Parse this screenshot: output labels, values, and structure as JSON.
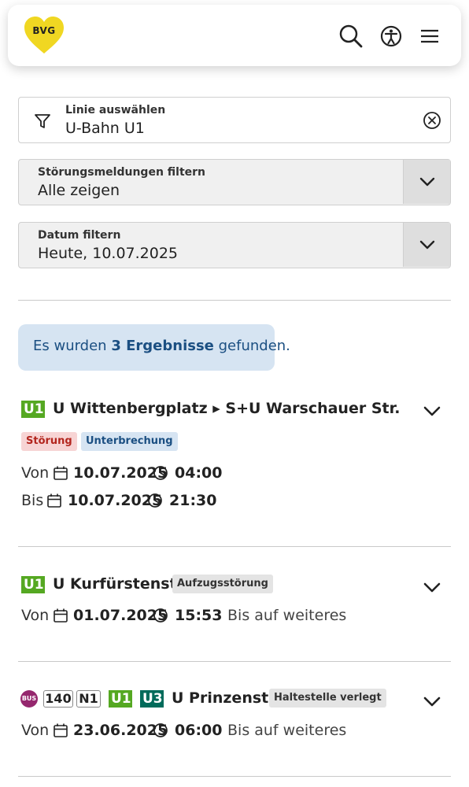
{
  "header": {
    "logo_text": "BVG",
    "brand_color": "#f0d722",
    "icons": [
      "search-icon",
      "accessibility-icon",
      "menu-icon"
    ]
  },
  "filters": {
    "line": {
      "label": "Linie auswählen",
      "value": "U-Bahn U1",
      "icon": "filter-icon",
      "clear_icon": "clear-icon"
    },
    "disruption": {
      "label": "Störungsmeldungen filtern",
      "value": "Alle zeigen"
    },
    "date": {
      "label": "Datum filtern",
      "value": "Heute, 10.07.2025"
    }
  },
  "result": {
    "prefix": "Es wurden ",
    "count": "3 Ergebnisse",
    "suffix": " gefunden."
  },
  "entries": [
    {
      "lines": [
        "U1"
      ],
      "title": "U Wittenbergplatz ▸ S+U Warschauer Str.",
      "tags": [
        "Störung",
        "Unterbrechung"
      ],
      "from": {
        "label": "Von",
        "date": "10.07.2025",
        "time": "04:00"
      },
      "to": {
        "label": "Bis",
        "date": "10.07.2025",
        "time": "21:30"
      }
    },
    {
      "lines": [
        "U1"
      ],
      "title": "U Kurfürstenstr.",
      "tags": [
        "Aufzugsstörung"
      ],
      "from": {
        "label": "Von",
        "date": "01.07.2025",
        "time": "15:53"
      },
      "until": "Bis auf weiteres"
    },
    {
      "bus_label": "BUS",
      "lines": [
        "140",
        "N1",
        "U1",
        "U3"
      ],
      "title": "U Prinzenstr.",
      "tags": [
        "Haltestelle verlegt"
      ],
      "from": {
        "label": "Von",
        "date": "23.06.2025",
        "time": "06:00"
      },
      "until": "Bis auf weiteres"
    }
  ],
  "colors": {
    "u1": "#55a822",
    "u3": "#016b5b",
    "bus": "#95276e",
    "info_bg": "#d6e4f2"
  }
}
